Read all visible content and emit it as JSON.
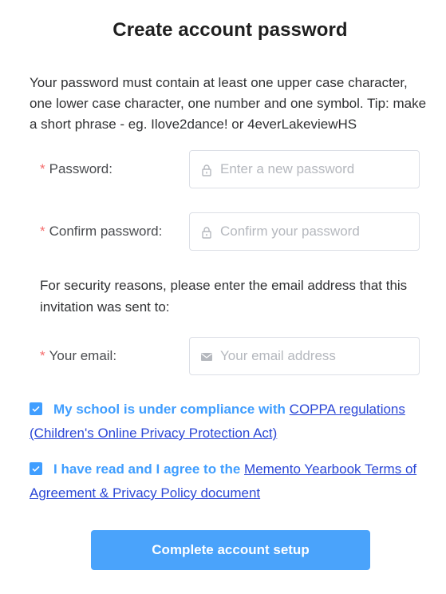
{
  "page": {
    "title": "Create account password",
    "intro": "Your password must contain at least one upper case character, one lower case character, one number and one symbol. Tip: make a short phrase - eg. Ilove2dance! or 4everLakeviewHS"
  },
  "form": {
    "required_mark": "*",
    "password": {
      "label": "Password:",
      "placeholder": "Enter a new password",
      "icon": "lock-icon"
    },
    "confirm_password": {
      "label": "Confirm password:",
      "placeholder": "Confirm your password",
      "icon": "lock-icon"
    },
    "security_note": "For security reasons, please enter the email address that this invitation was sent to:",
    "email": {
      "label": "Your email:",
      "placeholder": "Your email address",
      "icon": "envelope-icon"
    }
  },
  "agreements": {
    "coppa": {
      "checked": true,
      "text": "My school is under compliance with ",
      "link": "COPPA regulations (Children's Online Privacy Protection Act)"
    },
    "terms": {
      "checked": true,
      "text": "I have read and I agree to the ",
      "link": "Memento Yearbook Terms of Agreement & Privacy Policy document"
    }
  },
  "submit": {
    "label": "Complete account setup"
  },
  "colors": {
    "accent": "#409eff",
    "button": "#4aa3fb",
    "required": "#f56c6c",
    "link": "#2b47d6"
  }
}
